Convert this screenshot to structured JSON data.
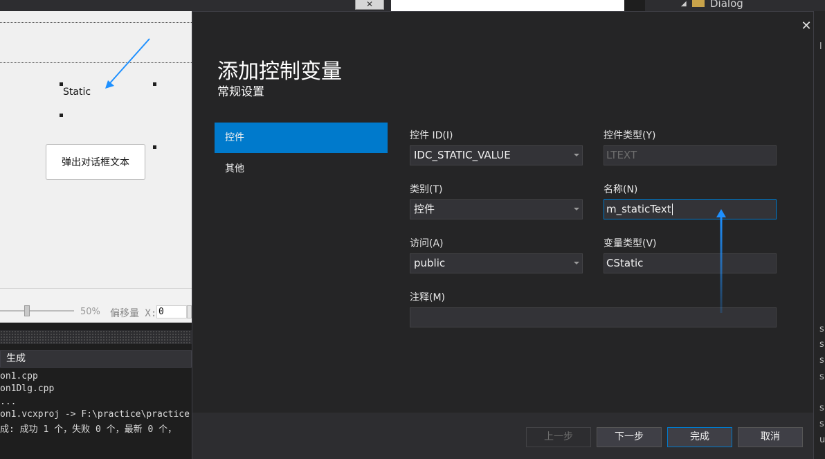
{
  "background": {
    "tree_label": "Dialog",
    "static_label": "Static",
    "popup_button": "弹出对话框文本",
    "zoom": "50%",
    "offset_label": "偏移量 X:",
    "offset_value": "0",
    "output_selector": "生成",
    "output_lines": [
      "on1.cpp",
      "on1Dlg.cpp",
      "...",
      "on1.vcxproj -> F:\\practice\\practice",
      "成: 成功 1 个，失败 0 个，最新 0 个，"
    ],
    "right_edge_letters": [
      "l",
      "s",
      "s",
      "s",
      "s",
      "s",
      "s",
      "u"
    ]
  },
  "dialog": {
    "title": "添加控制变量",
    "subtitle": "常规设置",
    "close_glyph": "✕",
    "nav": [
      {
        "label": "控件",
        "active": true
      },
      {
        "label": "其他",
        "active": false
      }
    ],
    "fields": {
      "control_id": {
        "label": "控件 ID(I)",
        "value": "IDC_STATIC_VALUE"
      },
      "control_type": {
        "label": "控件类型(Y)",
        "value": "LTEXT"
      },
      "category": {
        "label": "类别(T)",
        "value": "控件"
      },
      "name": {
        "label": "名称(N)",
        "value": "m_staticText"
      },
      "access": {
        "label": "访问(A)",
        "value": "public"
      },
      "var_type": {
        "label": "变量类型(V)",
        "value": "CStatic"
      },
      "comment": {
        "label": "注释(M)",
        "value": ""
      }
    },
    "buttons": {
      "prev": "上一步",
      "next": "下一步",
      "finish": "完成",
      "cancel": "取消"
    }
  },
  "colors": {
    "accent": "#007acc",
    "annotation_arrow": "#1e90ff"
  }
}
